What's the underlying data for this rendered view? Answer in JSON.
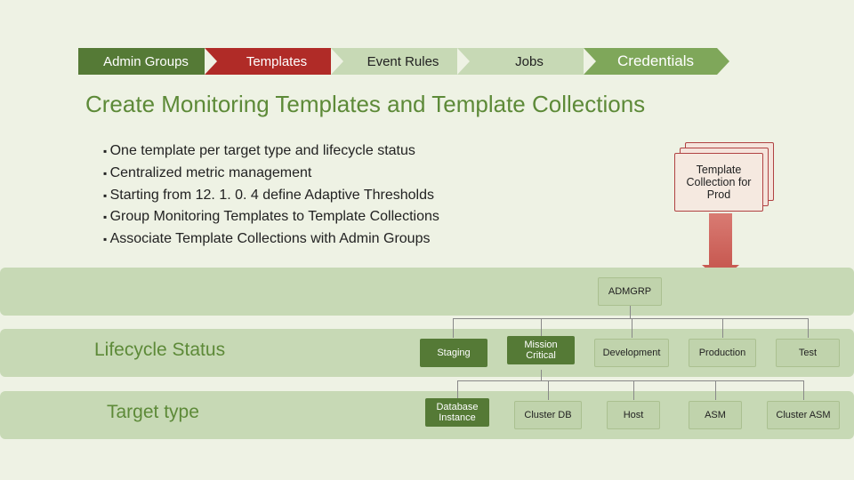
{
  "nav": [
    {
      "label": "Admin Groups"
    },
    {
      "label": "Templates"
    },
    {
      "label": "Event Rules"
    },
    {
      "label": "Jobs"
    },
    {
      "label": "Credentials"
    }
  ],
  "title": "Create Monitoring Templates and Template Collections",
  "bullets": [
    "One template per target type and lifecycle status",
    "Centralized metric management",
    "Starting from 12. 1. 0. 4 define Adaptive Thresholds",
    "Group Monitoring Templates to Template Collections",
    "Associate Template Collections with Admin Groups"
  ],
  "collection_card": "Template Collection for Prod",
  "tree": {
    "root": "ADMGRP",
    "lifecycle_label": "Lifecycle Status",
    "target_label": "Target type",
    "lifecycle": [
      "Staging",
      "Mission Critical",
      "Development",
      "Production",
      "Test"
    ],
    "targets": [
      "Database Instance",
      "Cluster DB",
      "Host",
      "ASM",
      "Cluster ASM"
    ]
  }
}
